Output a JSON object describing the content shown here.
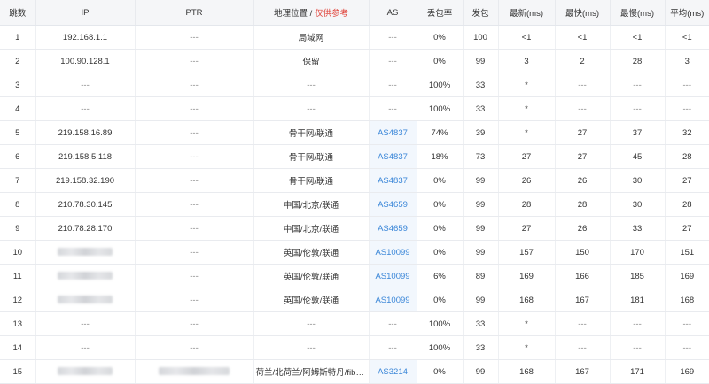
{
  "headers": {
    "hop": "跳数",
    "ip": "IP",
    "ptr": "PTR",
    "geo": "地理位置",
    "geo_sep": " / ",
    "geo_note": "仅供参考",
    "as": "AS",
    "loss": "丢包率",
    "sent": "发包",
    "latest": "最新(ms)",
    "best": "最快(ms)",
    "worst": "最慢(ms)",
    "avg": "平均(ms)"
  },
  "colors": {
    "link": "#3a86d8",
    "note": "#e0443b",
    "header_bg": "#f5f6f8",
    "as_cell_bg": "#f2f7fd"
  },
  "rows": [
    {
      "hop": "1",
      "ip": "192.168.1.1",
      "ptr": "---",
      "geo": "局域网",
      "as": "---",
      "loss": "0%",
      "sent": "100",
      "latest": "<1",
      "best": "<1",
      "worst": "<1",
      "avg": "<1"
    },
    {
      "hop": "2",
      "ip": "100.90.128.1",
      "ptr": "---",
      "geo": "保留",
      "as": "---",
      "loss": "0%",
      "sent": "99",
      "latest": "3",
      "best": "2",
      "worst": "28",
      "avg": "3"
    },
    {
      "hop": "3",
      "ip": "---",
      "ptr": "---",
      "geo": "---",
      "as": "---",
      "loss": "100%",
      "sent": "33",
      "latest": "*",
      "best": "---",
      "worst": "---",
      "avg": "---"
    },
    {
      "hop": "4",
      "ip": "---",
      "ptr": "---",
      "geo": "---",
      "as": "---",
      "loss": "100%",
      "sent": "33",
      "latest": "*",
      "best": "---",
      "worst": "---",
      "avg": "---"
    },
    {
      "hop": "5",
      "ip": "219.158.16.89",
      "ptr": "---",
      "geo": "骨干网/联通",
      "as": "AS4837",
      "loss": "74%",
      "sent": "39",
      "latest": "*",
      "best": "27",
      "worst": "37",
      "avg": "32"
    },
    {
      "hop": "6",
      "ip": "219.158.5.118",
      "ptr": "---",
      "geo": "骨干网/联通",
      "as": "AS4837",
      "loss": "18%",
      "sent": "73",
      "latest": "27",
      "best": "27",
      "worst": "45",
      "avg": "28"
    },
    {
      "hop": "7",
      "ip": "219.158.32.190",
      "ptr": "---",
      "geo": "骨干网/联通",
      "as": "AS4837",
      "loss": "0%",
      "sent": "99",
      "latest": "26",
      "best": "26",
      "worst": "30",
      "avg": "27"
    },
    {
      "hop": "8",
      "ip": "210.78.30.145",
      "ptr": "---",
      "geo": "中国/北京/联通",
      "as": "AS4659",
      "loss": "0%",
      "sent": "99",
      "latest": "28",
      "best": "28",
      "worst": "30",
      "avg": "28"
    },
    {
      "hop": "9",
      "ip": "210.78.28.170",
      "ptr": "---",
      "geo": "中国/北京/联通",
      "as": "AS4659",
      "loss": "0%",
      "sent": "99",
      "latest": "27",
      "best": "26",
      "worst": "33",
      "avg": "27"
    },
    {
      "hop": "10",
      "ip": "",
      "ptr": "---",
      "geo": "英国/伦敦/联通",
      "as": "AS10099",
      "loss": "0%",
      "sent": "99",
      "latest": "157",
      "best": "150",
      "worst": "170",
      "avg": "151"
    },
    {
      "hop": "11",
      "ip": "",
      "ptr": "---",
      "geo": "英国/伦敦/联通",
      "as": "AS10099",
      "loss": "6%",
      "sent": "89",
      "latest": "169",
      "best": "166",
      "worst": "185",
      "avg": "169"
    },
    {
      "hop": "12",
      "ip": "",
      "ptr": "---",
      "geo": "英国/伦敦/联通",
      "as": "AS10099",
      "loss": "0%",
      "sent": "99",
      "latest": "168",
      "best": "167",
      "worst": "181",
      "avg": "168"
    },
    {
      "hop": "13",
      "ip": "---",
      "ptr": "---",
      "geo": "---",
      "as": "---",
      "loss": "100%",
      "sent": "33",
      "latest": "*",
      "best": "---",
      "worst": "---",
      "avg": "---"
    },
    {
      "hop": "14",
      "ip": "---",
      "ptr": "---",
      "geo": "---",
      "as": "---",
      "loss": "100%",
      "sent": "33",
      "latest": "*",
      "best": "---",
      "worst": "---",
      "avg": "---"
    },
    {
      "hop": "15",
      "ip": "",
      "ptr": "",
      "geo": "荷兰/北荷兰/阿姆斯特丹/fiber...",
      "as": "AS3214",
      "loss": "0%",
      "sent": "99",
      "latest": "168",
      "best": "167",
      "worst": "171",
      "avg": "169"
    }
  ]
}
